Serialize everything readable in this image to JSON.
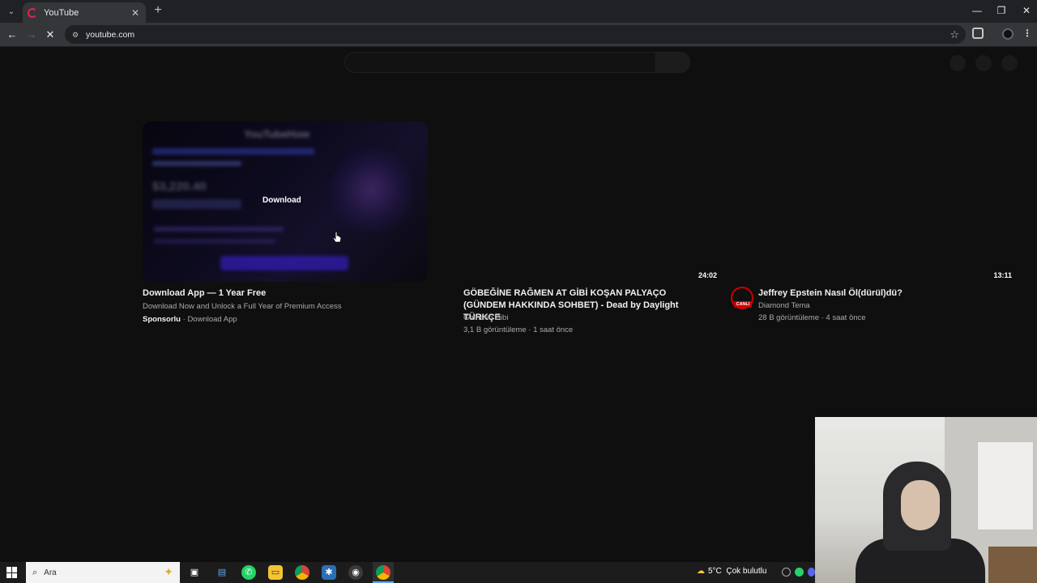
{
  "browser": {
    "tab_title": "YouTube",
    "tab_close": "✕",
    "new_tab": "+",
    "url": "youtube.com",
    "window_controls": {
      "minimize": "—",
      "restore": "❐",
      "close": "✕"
    },
    "nav": {
      "back": "←",
      "forward": "→",
      "reload": "✕"
    }
  },
  "ad": {
    "thumb_logo": "YouTubeHow",
    "thumb_amount": "$3,220.40",
    "overlay_label": "Download",
    "title": "Download App — 1 Year Free",
    "description": "Download Now and Unlock a Full Year of Premium Access",
    "sponsored": "Sponsorlu",
    "separator": " · ",
    "advertiser": "Download App"
  },
  "videos": [
    {
      "duration": "24:02",
      "title": "GÖBEĞİNE RAĞMEN AT GİBİ KOŞAN PALYAÇO (GÜNDEM HAKKINDA SOHBET) - Dead by Daylight TÜRKÇE",
      "channel": "Gamerin Dibi",
      "stats": "3,1 B görüntüleme · 1 saat önce"
    },
    {
      "duration": "13:11",
      "title": "Jeffrey Epstein Nasıl Öl(dürül)dü?",
      "channel": "Diamond Tema",
      "stats": "28 B görüntüleme · 4 saat önce",
      "live_badge": "CANLI"
    }
  ],
  "taskbar": {
    "search_placeholder": "Ara",
    "weather_temp": "5°C",
    "weather_text": "Çok bulutlu",
    "apps": [
      "task-view",
      "file-icon",
      "whatsapp",
      "file-explorer",
      "chrome",
      "settings",
      "obs",
      "chrome-active"
    ]
  },
  "colors": {
    "page_bg": "#0f0f0f",
    "live_red": "#cc0000",
    "chrome_bg": "#202124",
    "toolbar_bg": "#35363a"
  }
}
